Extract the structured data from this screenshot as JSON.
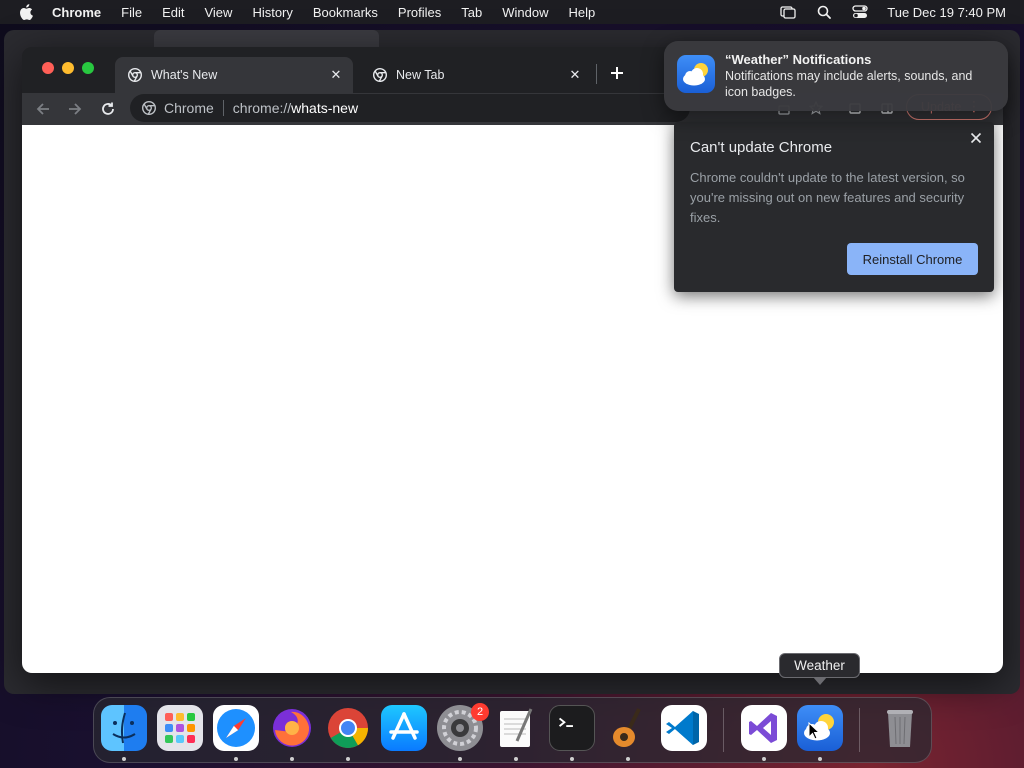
{
  "menubar": {
    "app_name": "Chrome",
    "items": [
      "File",
      "Edit",
      "View",
      "History",
      "Bookmarks",
      "Profiles",
      "Tab",
      "Window",
      "Help"
    ],
    "clock": "Tue Dec 19  7:40 PM",
    "status_icons": [
      "screen-mirroring-icon",
      "spotlight-search-icon",
      "control-center-icon"
    ]
  },
  "browser": {
    "tabs": [
      {
        "title": "What's New",
        "active": true,
        "icon": "chrome-icon"
      },
      {
        "title": "New Tab",
        "active": false,
        "icon": "chrome-icon"
      }
    ],
    "omnibox": {
      "label": "Chrome",
      "url_scheme": "chrome://",
      "url_host": "whats-new"
    },
    "update_button_label": "Update"
  },
  "update_bubble": {
    "title": "Can't update Chrome",
    "body": "Chrome couldn't update to the latest version, so you're missing out on new features and security fixes.",
    "button_label": "Reinstall Chrome"
  },
  "notification": {
    "title": "“Weather” Notifications",
    "body": "Notifications may include alerts, sounds, and icon badges.",
    "icon": "weather-icon"
  },
  "dock": {
    "apps": [
      "Finder",
      "Launchpad",
      "Safari",
      "Firefox",
      "Google Chrome",
      "App Store",
      "System Settings",
      "TextEdit",
      "Terminal",
      "GarageBand",
      "Visual Studio Code",
      "Visual Studio",
      "Weather",
      "Trash"
    ],
    "settings_badge": "2",
    "tooltip": "Weather"
  },
  "colors": {
    "accent_blue": "#8ab4f8",
    "update_red": "#f28b82",
    "chrome_dark": "#202124"
  }
}
